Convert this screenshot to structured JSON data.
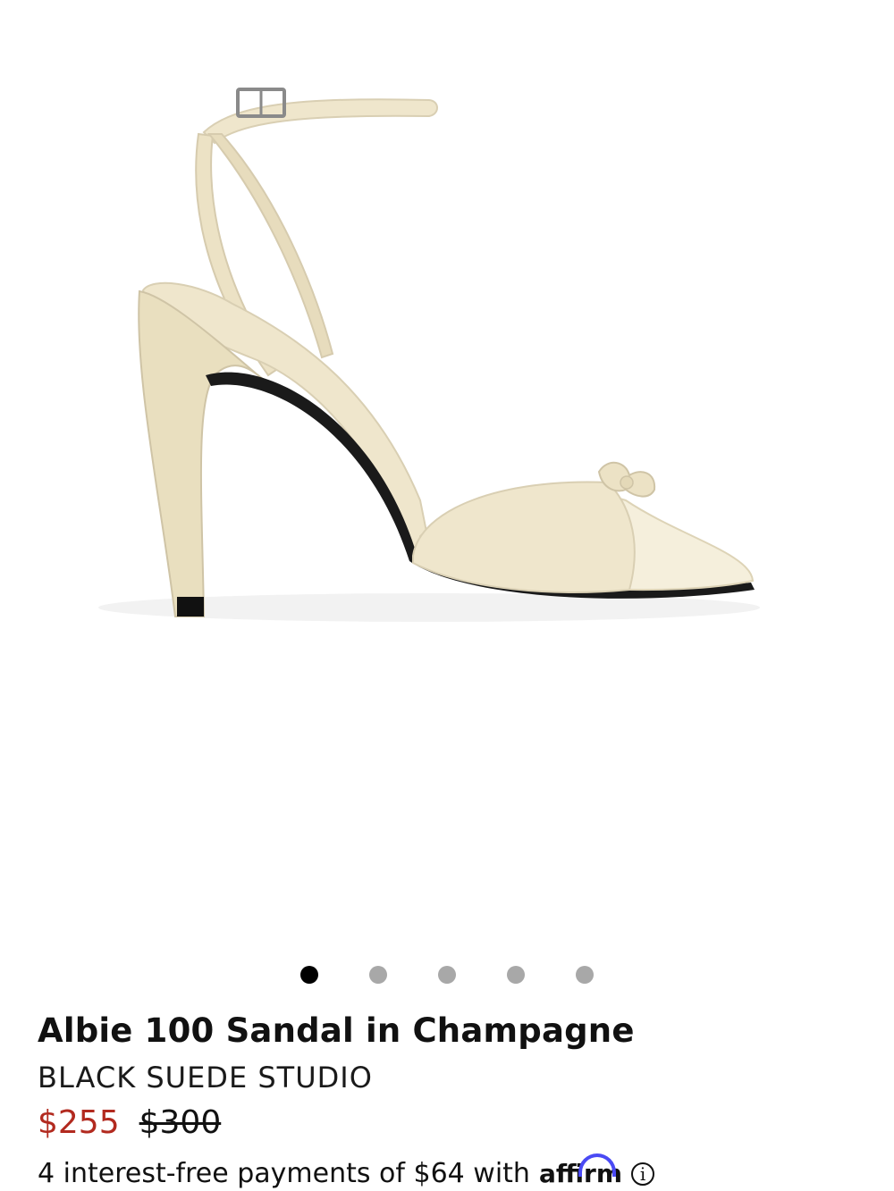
{
  "product": {
    "image_alt": "Albie 100 Sandal in Champagne",
    "title": "Albie 100 Sandal in Champagne",
    "brand": "BLACK SUEDE STUDIO",
    "price_sale": "$255",
    "price_original": "$300"
  },
  "carousel": {
    "total": 5,
    "active_index": 0
  },
  "payment": {
    "text": "4 interest-free payments of $64 with",
    "provider": "affirm",
    "info_icon": "info-icon",
    "info_glyph": "i"
  },
  "colors": {
    "sale_price": "#b22a1f",
    "dot_active": "#000000",
    "dot_inactive": "#a8a8a8",
    "affirm_arc": "#4a4af4",
    "shoe": "#efe6cc"
  }
}
